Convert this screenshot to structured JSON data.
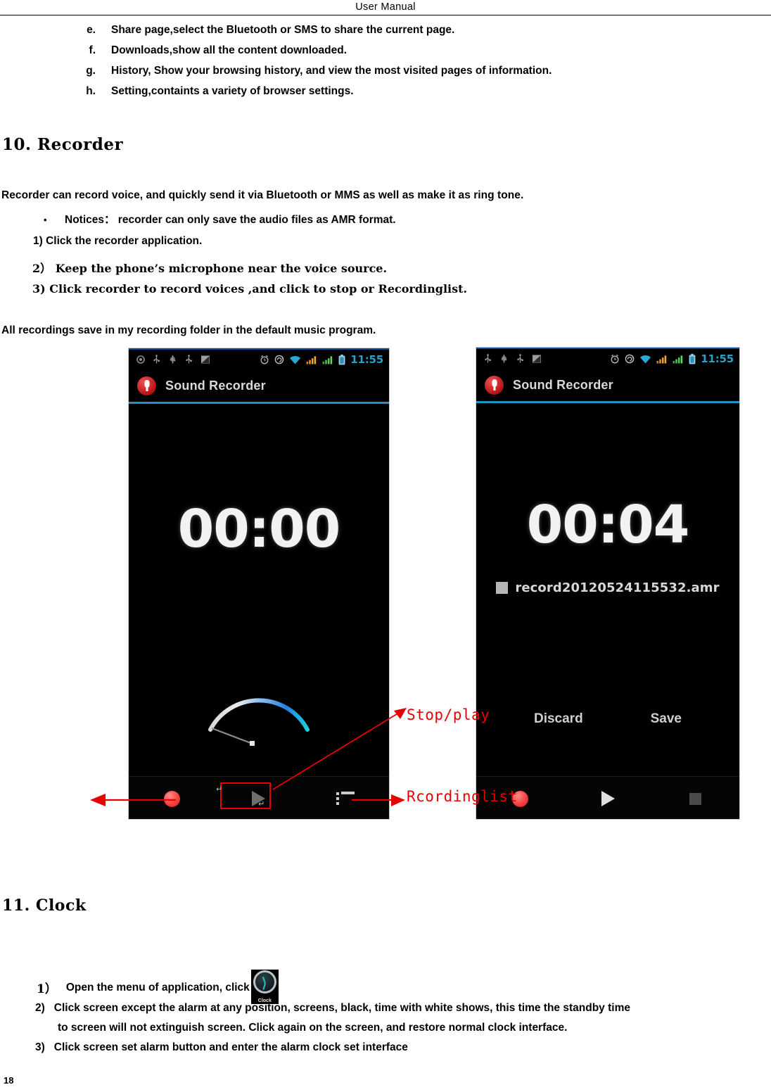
{
  "header": {
    "title": "User  Manual"
  },
  "browser_list": [
    {
      "marker": "e.",
      "text": "Share page,select the Bluetooth or SMS to share the current page."
    },
    {
      "marker": "f.",
      "text": "Downloads,show all the content downloaded."
    },
    {
      "marker": "g.",
      "text": "History, Show your browsing history, and view the most visited pages of information."
    },
    {
      "marker": "h.",
      "text": "Setting,containts a variety of browser settings."
    }
  ],
  "recorder": {
    "heading": "10.  Recorder",
    "intro": "Recorder   can record   voice, and   quickly   send   it   via   Bluetooth or MMS as well as make it as ring tone.",
    "notice_bullet": "•",
    "notice": "Notices： recorder can only save the audio files as AMR format.",
    "steps": [
      "1) Click the recorder application.",
      "2） Keep the phone’s microphone near the voice source.",
      "3) Click recorder to record voices ,and click to stop or Recordinglist."
    ],
    "all_recordings": "All recordings save in my recording folder in the default music program."
  },
  "annotations": {
    "stop_play": "Stop/play",
    "recording_list": "Rcordinglist"
  },
  "phone_left": {
    "statusbar": {
      "left_icons": [
        "dot-icon",
        "usb-icon",
        "usb-debug-icon",
        "usb-icon",
        "sdcard-icon"
      ],
      "right_icons": [
        "alarm-icon",
        "sync-icon",
        "wifi-icon",
        "signal-sim1-icon",
        "signal-sim2-icon",
        "battery-icon"
      ],
      "time": "11:55"
    },
    "app_title": "Sound Recorder",
    "timer": "00:00",
    "controls": [
      "record-button",
      "play-button",
      "recording-list-button"
    ]
  },
  "phone_right": {
    "statusbar": {
      "left_icons": [
        "usb-icon",
        "usb-debug-icon",
        "usb-icon",
        "sdcard-icon"
      ],
      "right_icons": [
        "alarm-icon",
        "sync-icon",
        "wifi-icon",
        "signal-sim1-icon",
        "signal-sim2-icon",
        "battery-icon"
      ],
      "time": "11:55"
    },
    "app_title": "Sound Recorder",
    "timer": "00:04",
    "filename": "record20120524115532.amr",
    "discard_label": "Discard",
    "save_label": "Save",
    "controls": [
      "record-button",
      "play-button",
      "stop-button"
    ]
  },
  "clock": {
    "heading": "11. Clock",
    "icon_label": "Clock",
    "steps": [
      {
        "num": "1）",
        "text": "Open the menu of application, click"
      },
      {
        "num": "2)",
        "line1": "Click screen except the alarm at any position, screens, black, time with white shows, this time the standby time",
        "line2": "to screen will not extinguish screen. Click again on the screen, and restore normal clock interface."
      },
      {
        "num": "3)",
        "text": "Click screen set alarm button and enter the alarm clock set interface"
      }
    ]
  },
  "page_number": "18",
  "colors": {
    "annotation_red": "#e60000",
    "status_cyan": "#2d9ec4",
    "appbar_underline": "#1f8fc4",
    "record_red": "#f23b3b"
  }
}
